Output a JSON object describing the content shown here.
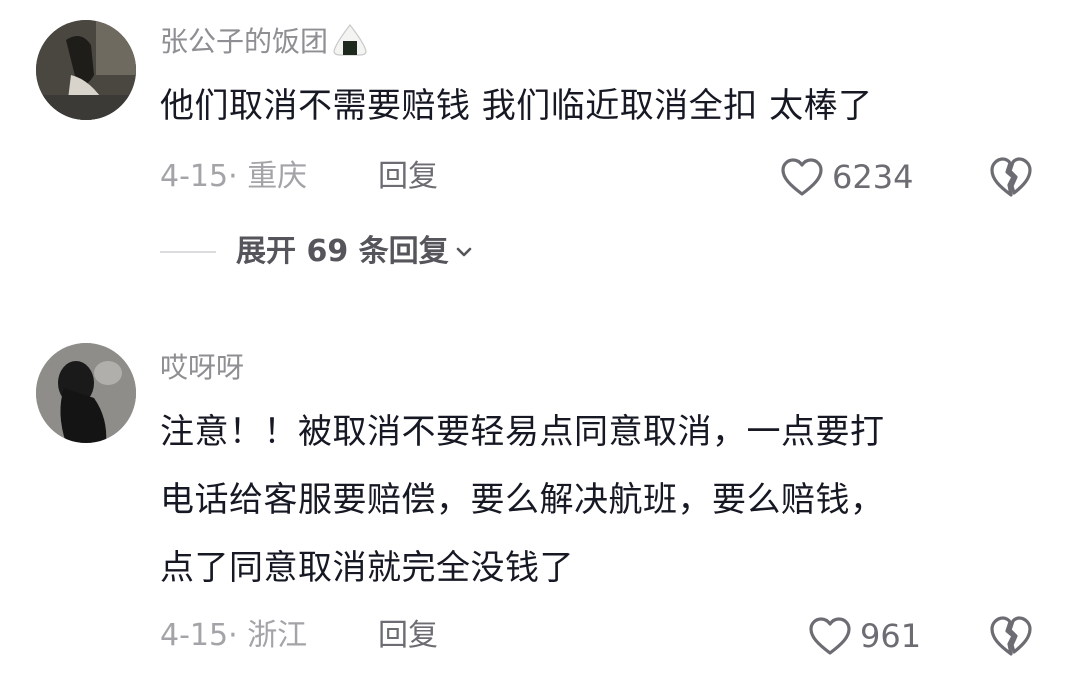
{
  "comments": [
    {
      "username": "张公子的饭团",
      "username_emoji": "rice-ball-emoji",
      "text_lines": [
        "他们取消不需要赔钱 我们临近取消全扣 太棒了"
      ],
      "date": "4-15",
      "separator": "·",
      "location": "重庆",
      "reply_label": "回复",
      "likes": "6234",
      "expand_label": "展开 69 条回复"
    },
    {
      "username": "哎呀呀",
      "text_lines": [
        "注意！！被取消不要轻易点同意取消，一点要打",
        "电话给客服要赔偿，要么解决航班，要么赔钱，",
        "点了同意取消就完全没钱了"
      ],
      "date": "4-15",
      "separator": "·",
      "location": "浙江",
      "reply_label": "回复",
      "likes": "961"
    }
  ],
  "colors": {
    "text": "#161823",
    "secondary": "#8e8e93",
    "meta": "#a3a3a8",
    "icon": "#6c6c72"
  },
  "icons": {
    "like": "heart-outline-icon",
    "dislike": "broken-heart-icon",
    "expand": "chevron-down-icon"
  }
}
